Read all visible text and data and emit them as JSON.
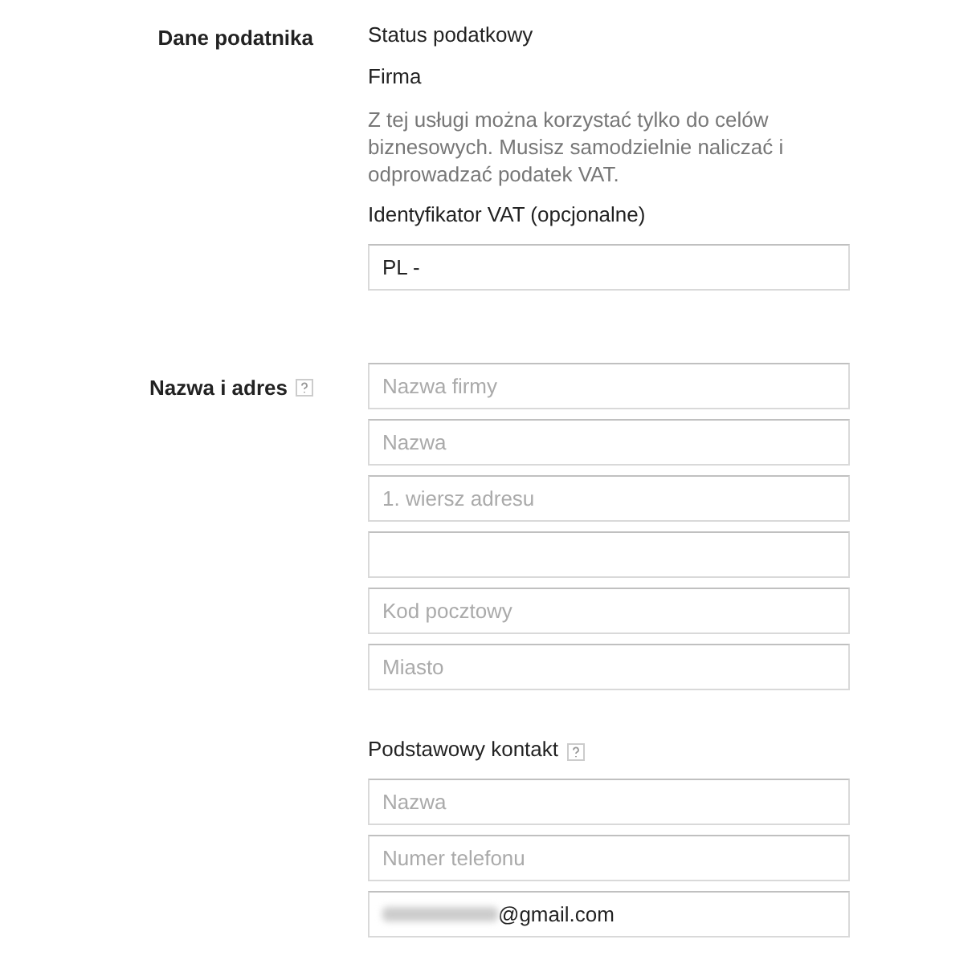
{
  "sections": [
    {
      "label": "Dane podatnika",
      "help": false,
      "items": [
        {
          "kind": "text",
          "text": "Status podatkowy"
        },
        {
          "kind": "text",
          "text": "Firma"
        },
        {
          "kind": "note",
          "text": "Z tej usługi można korzystać tylko do celów biznesowych. Musisz samodzielnie naliczać i odprowadzać podatek VAT."
        },
        {
          "kind": "text",
          "text": "Identyfikator VAT (opcjonalne)"
        },
        {
          "kind": "field",
          "value": "PL -"
        }
      ]
    },
    {
      "label": "Nazwa i adres",
      "help": true,
      "items": [
        {
          "kind": "field",
          "placeholder": "Nazwa firmy"
        },
        {
          "kind": "field",
          "placeholder": "Nazwa"
        },
        {
          "kind": "field",
          "placeholder": "1. wiersz adresu"
        },
        {
          "kind": "field"
        },
        {
          "kind": "field",
          "placeholder": "Kod pocztowy"
        },
        {
          "kind": "field",
          "placeholder": "Miasto"
        },
        {
          "kind": "subheading",
          "text": "Podstawowy kontakt",
          "help": true
        },
        {
          "kind": "field",
          "placeholder": "Nazwa"
        },
        {
          "kind": "field",
          "placeholder": "Numer telefonu"
        },
        {
          "kind": "field",
          "value": "@gmail.com",
          "blurred_prefix": true
        }
      ]
    }
  ]
}
